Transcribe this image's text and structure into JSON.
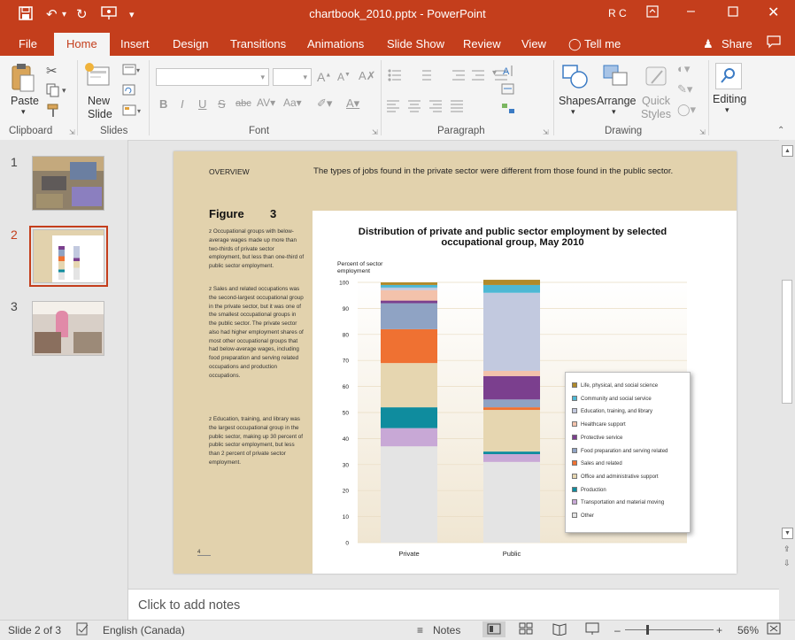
{
  "window": {
    "title": "chartbook_2010.pptx  -  PowerPoint",
    "user": "R C"
  },
  "tabs": [
    "File",
    "Home",
    "Insert",
    "Design",
    "Transitions",
    "Animations",
    "Slide Show",
    "Review",
    "View",
    "Tell me",
    "Share"
  ],
  "ribbon": {
    "paste_label": "Paste",
    "new_slide_label": "New Slide",
    "shapes_label": "Shapes",
    "arrange_label": "Arrange",
    "quick_styles_label": "Quick Styles",
    "editing_label": "Editing",
    "groups": [
      "Clipboard",
      "Slides",
      "Font",
      "Paragraph",
      "Drawing"
    ]
  },
  "thumbnails": [
    {
      "num": "1"
    },
    {
      "num": "2",
      "selected": true
    },
    {
      "num": "3"
    }
  ],
  "slide": {
    "overview": "OVERVIEW",
    "headline": "The types of jobs found in the private sector were different from those found in the public sector.",
    "figure_label": "Figure",
    "figure_num": "3",
    "para1": "z Occupational groups with below-average wages made up more than two-thirds of private sector employment, but less than one-third of public sector employment.",
    "para2": "z Sales and related occupations was the second-largest occupational group in the private sector, but it was one of the smallest occupational groups in the public sector. The private sector also had higher employment shares of most other occupational groups that had below-average wages, including food preparation and serving related occupations and production occupations.",
    "para3": "z Education, training, and library was the largest occupational group in the public sector, making up 30 percent of public sector employment, but less than 2 percent of private sector employment.",
    "page_num": "4"
  },
  "chart_data": {
    "type": "bar",
    "stacked": true,
    "title": "Distribution of private and public sector employment by selected occupational group, May 2010",
    "ylabel": "Percent of sector employment",
    "ylim": [
      0,
      100
    ],
    "yticks": [
      0,
      10,
      20,
      30,
      40,
      50,
      60,
      70,
      80,
      90,
      100
    ],
    "categories": [
      "Private",
      "Public"
    ],
    "series": [
      {
        "name": "Other",
        "color": "#e4e4e4",
        "values": [
          37,
          31
        ]
      },
      {
        "name": "Transportation and material moving",
        "color": "#c8a8d6",
        "values": [
          7,
          3
        ]
      },
      {
        "name": "Production",
        "color": "#0f8c9e",
        "values": [
          8,
          1
        ]
      },
      {
        "name": "Office and administrative support",
        "color": "#e6d6b0",
        "values": [
          17,
          16
        ]
      },
      {
        "name": "Sales and related",
        "color": "#ef7132",
        "values": [
          13,
          1
        ]
      },
      {
        "name": "Food preparation and serving related",
        "color": "#8fa3c4",
        "values": [
          10,
          3
        ]
      },
      {
        "name": "Protective service",
        "color": "#7b3f8e",
        "values": [
          1,
          9
        ]
      },
      {
        "name": "Healthcare support",
        "color": "#f3c2ab",
        "values": [
          4,
          2
        ]
      },
      {
        "name": "Education, training, and library",
        "color": "#c2c9df",
        "values": [
          1,
          30
        ]
      },
      {
        "name": "Community and social service",
        "color": "#4db8d4",
        "values": [
          1,
          3
        ]
      },
      {
        "name": "Life, physical, and social science",
        "color": "#b08a2a",
        "values": [
          1,
          2
        ]
      }
    ]
  },
  "notes_placeholder": "Click to add notes",
  "status": {
    "slide_info": "Slide 2 of 3",
    "language": "English (Canada)",
    "notes_label": "Notes",
    "zoom": "56%"
  }
}
